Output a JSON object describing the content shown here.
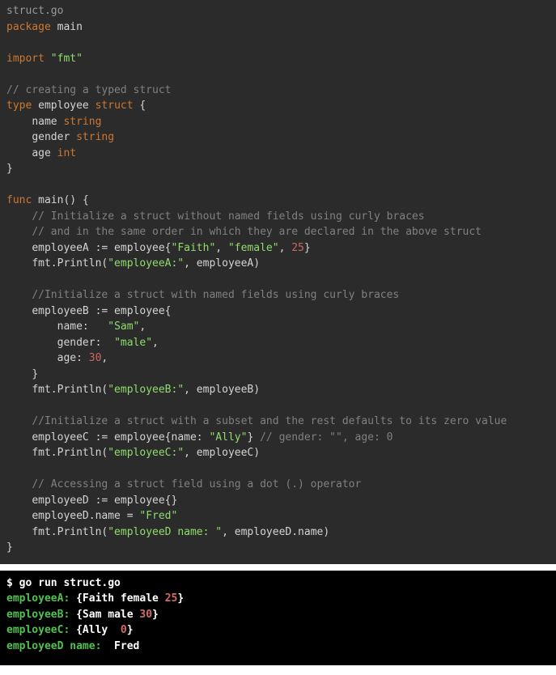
{
  "filename": "struct.go",
  "code": {
    "pkg_kw": "package",
    "pkg_name": "main",
    "import_kw": "import",
    "import_val": "\"fmt\"",
    "comment_struct": "// creating a typed struct",
    "type_kw": "type",
    "type_name": "employee",
    "struct_kw": "struct",
    "brace_open": "{",
    "field_name": "name",
    "field_name_type": "string",
    "field_gender": "gender",
    "field_gender_type": "string",
    "field_age": "age",
    "field_age_type": "int",
    "brace_close": "}",
    "func_kw": "func",
    "main_name": "main",
    "parens": "()",
    "comment_init1": "// Initialize a struct without named fields using curly braces",
    "comment_init2": "// and in the same order in which they are declared in the above struct",
    "empA_decl": "employeeA := employee{",
    "empA_s1": "\"Faith\"",
    "comma": ", ",
    "empA_s2": "\"female\"",
    "empA_n": "25",
    "empA_close": "}",
    "println": "fmt.Println(",
    "empA_label": "\"employeeA:\"",
    "empA_arg": ", employeeA)",
    "comment_init3": "//Initialize a struct with named fields using curly braces",
    "empB_decl": "employeeB := employee{",
    "empB_name_k": "name:   ",
    "empB_name_v": "\"Sam\"",
    "empB_gender_k": "gender:  ",
    "empB_gender_v": "\"male\"",
    "empB_age_k": "age: ",
    "empB_age_v": "30",
    "empB_close": "}",
    "empB_label": "\"employeeB:\"",
    "empB_arg": ", employeeB)",
    "comment_init4": "//Initialize a struct with a subset and the rest defaults to its zero value",
    "empC_decl": "employeeC := employee{name: ",
    "empC_name_v": "\"Ally\"",
    "empC_close": "}",
    "empC_comment": " // gender: \"\", age: 0",
    "empC_label": "\"employeeC:\"",
    "empC_arg": ", employeeC)",
    "comment_init5": "// Accessing a struct field using a dot (.) operator",
    "empD_decl": "employeeD := employee{}",
    "empD_assign": "employeeD.name = ",
    "empD_val": "\"Fred\"",
    "empD_label": "\"employeeD name: \"",
    "empD_arg": ", employeeD.name)"
  },
  "terminal": {
    "prompt": "$ ",
    "cmd": "go run struct.go",
    "lineA_label": "employeeA:",
    "lineA_pre": " {Faith female ",
    "lineA_num": "25",
    "lineA_post": "}",
    "lineB_label": "employeeB:",
    "lineB_pre": " {Sam male ",
    "lineB_num": "30",
    "lineB_post": "}",
    "lineC_label": "employeeC:",
    "lineC_pre": " {Ally  ",
    "lineC_num": "0",
    "lineC_post": "}",
    "lineD_label": "employeeD name:",
    "lineD_val": "  Fred"
  }
}
